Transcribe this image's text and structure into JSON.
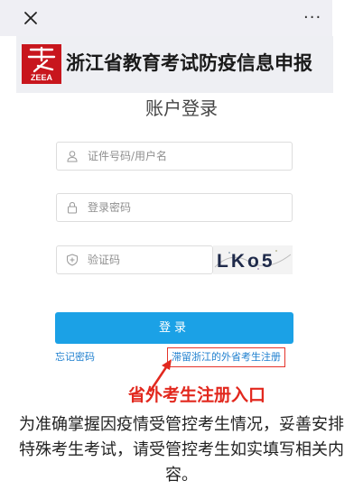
{
  "topbar": {
    "more_label": "···"
  },
  "banner": {
    "logo_text": "ZEEA",
    "title": "浙江省教育考试防疫信息申报"
  },
  "login": {
    "title": "账户登录",
    "username_placeholder": "证件号码/用户名",
    "password_placeholder": "登录密码",
    "captcha_placeholder": "验证码",
    "captcha_text": "LKo5",
    "login_label": "登录",
    "forgot_label": "忘记密码",
    "register_label": "滞留浙江的外省考生注册"
  },
  "annotation": {
    "label": "省外考生注册入口",
    "note": "为准确掌握因疫情受管控考生情况，妥善安排特殊考生考试，请受管控考生如实填写相关内容。"
  },
  "colors": {
    "accent": "#1ba1e6",
    "link": "#1e7fcf",
    "annotation_red": "#e2281e",
    "logo_red": "#c8161d"
  }
}
